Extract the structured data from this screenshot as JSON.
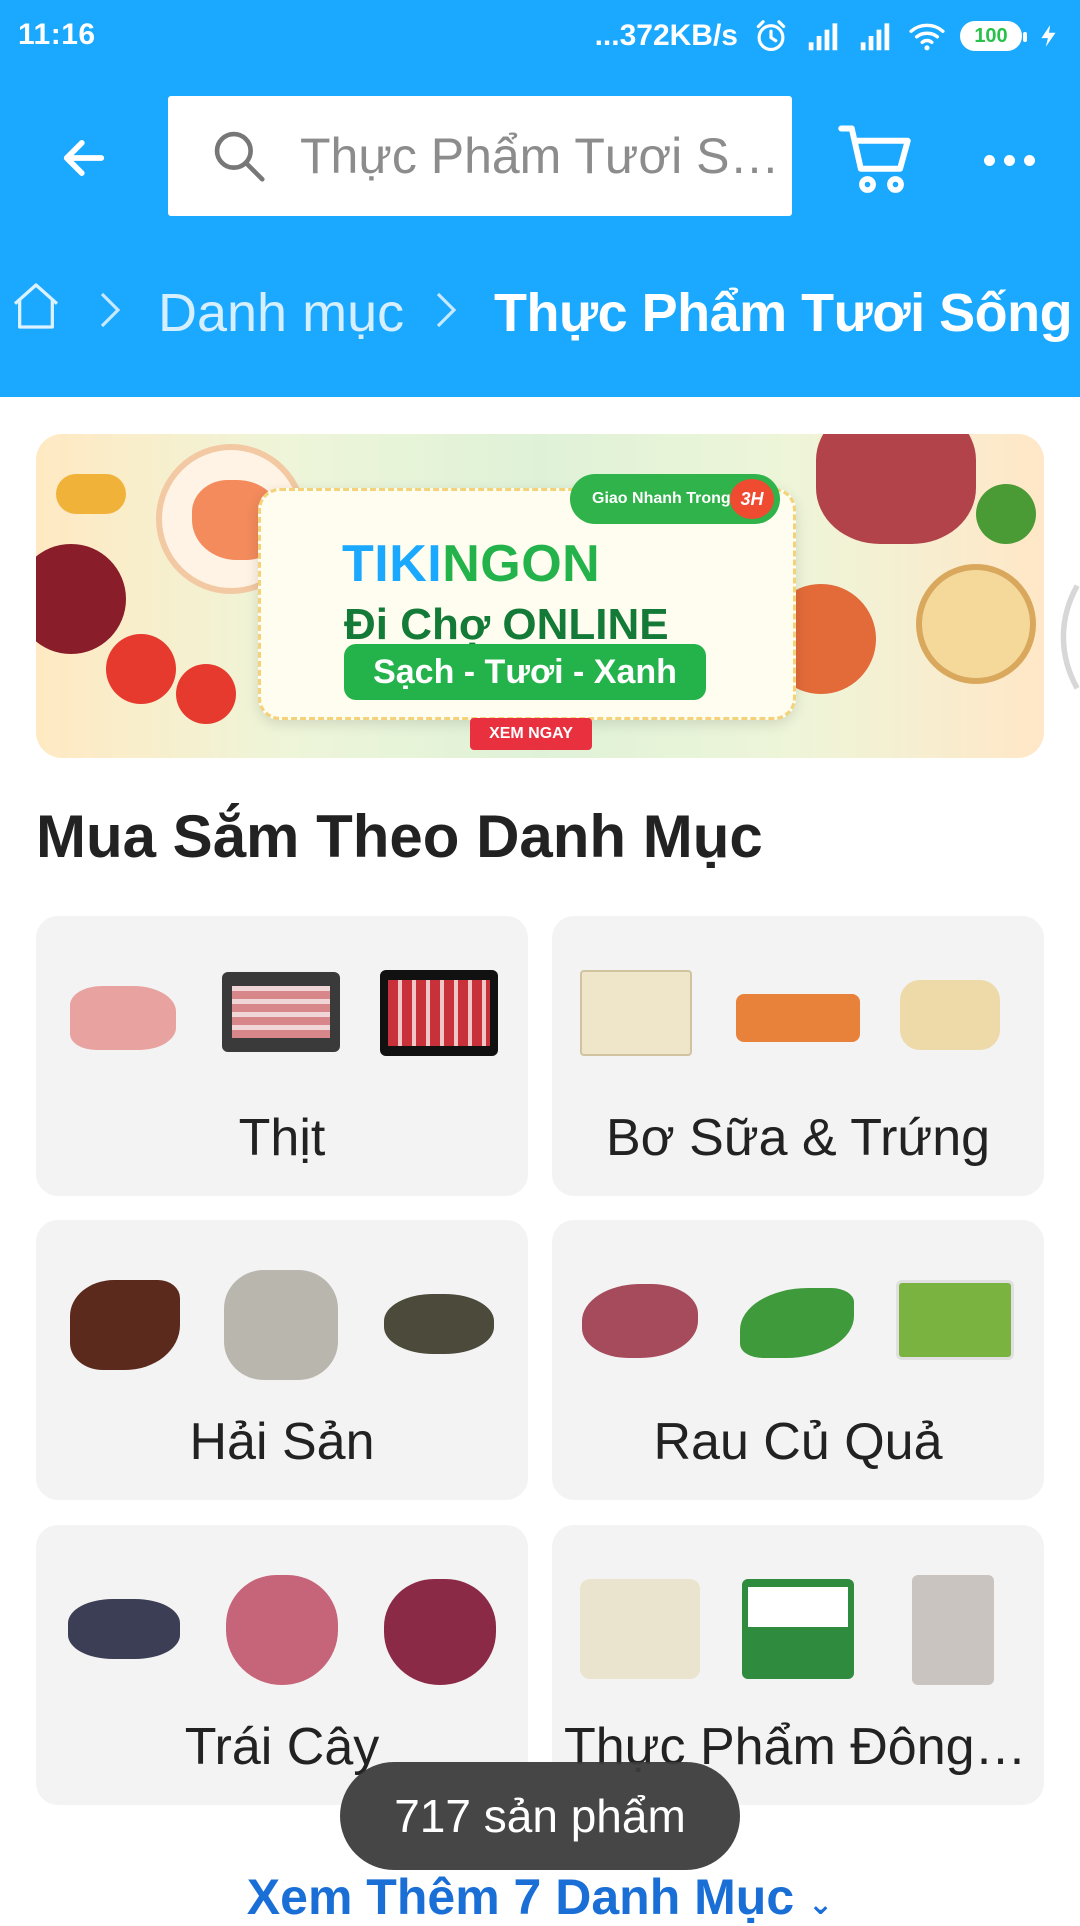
{
  "status_bar": {
    "time": "11:16",
    "network_speed": "...372KB/s",
    "battery_level": "100",
    "icons": [
      "alarm-icon",
      "signal-icon",
      "signal-icon",
      "wifi-icon",
      "battery-icon",
      "charging-icon"
    ]
  },
  "header": {
    "search_placeholder": "Thực Phẩm Tươi Sống",
    "back_icon": "arrow-left-icon",
    "search_icon": "search-icon",
    "cart_icon": "cart-icon",
    "more_icon": "more-dots-icon"
  },
  "breadcrumb": {
    "home_icon": "home-icon",
    "items": [
      "Danh mục",
      "Thực Phẩm Tươi Sống"
    ]
  },
  "banner": {
    "express_label": "Giao Nhanh Trong",
    "express_badge": "3H",
    "brand_tiki": "TIKI",
    "brand_ngon": "NGON",
    "tagline": "Đi Chợ ONLINE",
    "subtitle": "Sạch - Tươi - Xanh",
    "cta": "XEM NGAY"
  },
  "section": {
    "title": "Mua Sắm Theo Danh Mục"
  },
  "categories": [
    {
      "label": "Thịt",
      "thumbs": [
        "#e8a3a0",
        "#3a3a3a",
        "#c8303a"
      ]
    },
    {
      "label": "Bơ Sữa & Trứng",
      "thumbs": [
        "#efe6c9",
        "#e8823b",
        "#eed9a9"
      ]
    },
    {
      "label": "Hải Sản",
      "thumbs": [
        "#5b2a1d",
        "#b9b6ae",
        "#4c4a3a"
      ]
    },
    {
      "label": "Rau Củ Quả",
      "thumbs": [
        "#a54b5c",
        "#3e9a3a",
        "#7bb341"
      ]
    },
    {
      "label": "Trái Cây",
      "thumbs": [
        "#3b3e54",
        "#c6657a",
        "#8b2a47"
      ]
    },
    {
      "label": "Thực Phẩm Đông Lạnh",
      "thumbs": [
        "#eae4cf",
        "#2f8b3e",
        "#c9c4c0"
      ]
    }
  ],
  "toast": {
    "text": "717 sản phẩm"
  },
  "more_link": {
    "text": "Xem Thêm 7 Danh Mục"
  },
  "colors": {
    "primary": "#1ba8ff",
    "tile_bg": "#f3f3f3",
    "link": "#1a6fd6"
  }
}
